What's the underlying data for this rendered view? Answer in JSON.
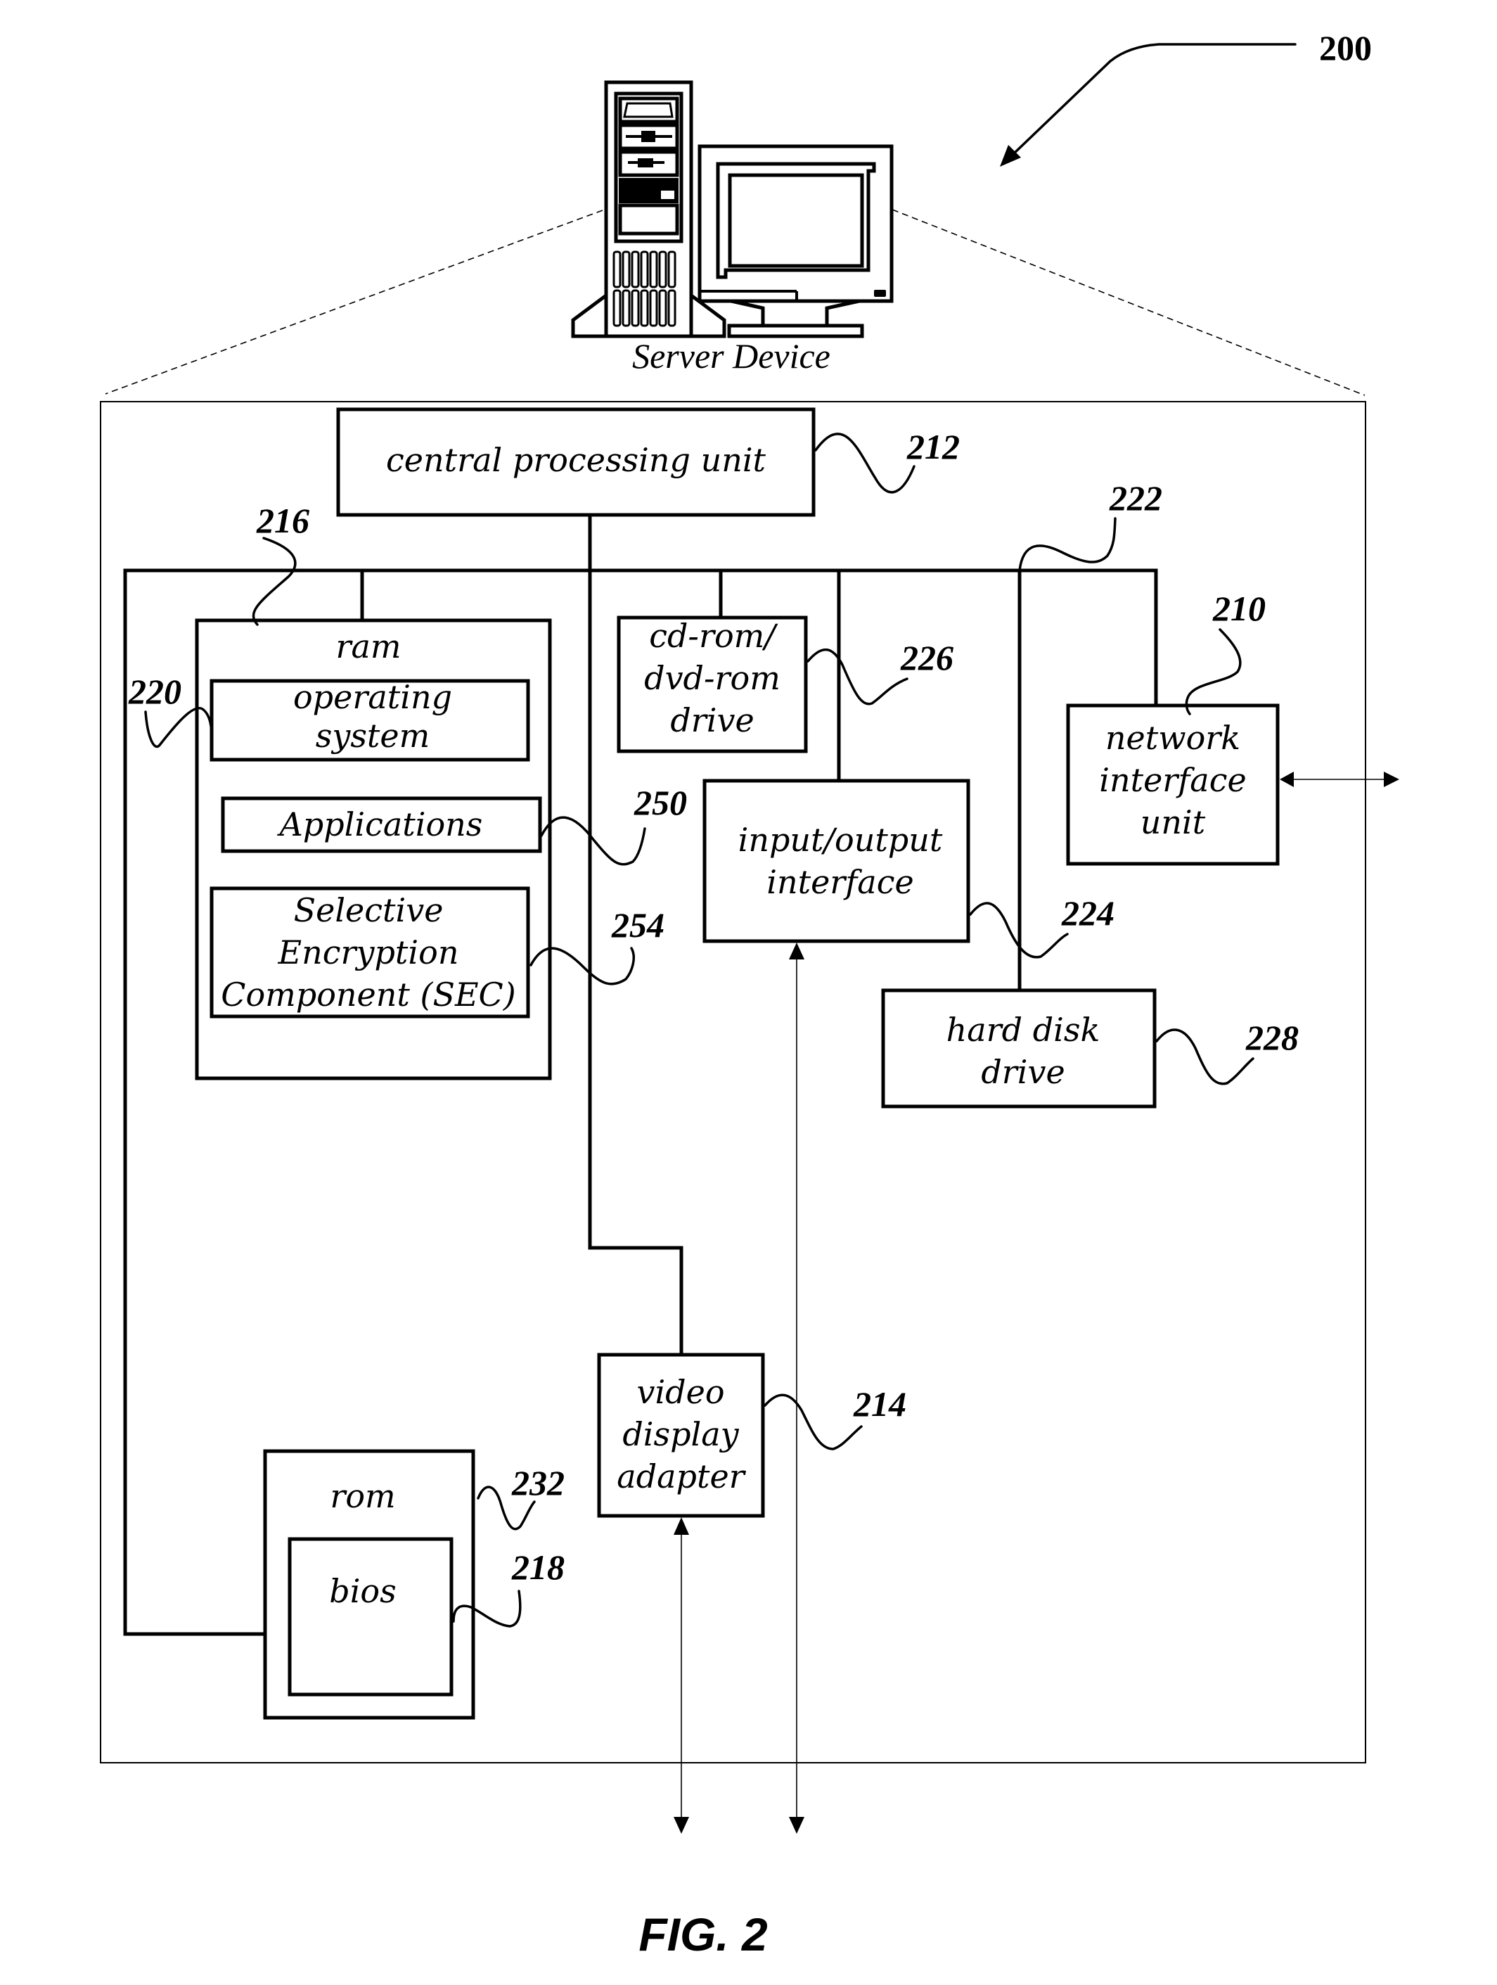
{
  "figure": {
    "label": "FIG. 2",
    "reference_number": "200",
    "device_caption": "Server Device"
  },
  "components": {
    "cpu": {
      "label": [
        "central processing unit"
      ],
      "ref": "212"
    },
    "ram": {
      "label": [
        "ram"
      ],
      "ref": "216"
    },
    "os": {
      "label": [
        "operating",
        "system"
      ],
      "ref": "220"
    },
    "applications": {
      "label": [
        "Applications"
      ],
      "ref": "250"
    },
    "sec": {
      "label": [
        "Selective",
        "Encryption",
        "Component (SEC)"
      ],
      "ref": "254"
    },
    "cdrom": {
      "label": [
        "cd-rom/",
        "dvd-rom",
        "drive"
      ],
      "ref": "226"
    },
    "io": {
      "label": [
        "input/output",
        "interface"
      ],
      "ref": "224"
    },
    "bus": {
      "ref": "222"
    },
    "nic": {
      "label": [
        "network",
        "interface",
        "unit"
      ],
      "ref": "210"
    },
    "hdd": {
      "label": [
        "hard disk",
        "drive"
      ],
      "ref": "228"
    },
    "video": {
      "label": [
        "video",
        "display",
        "adapter"
      ],
      "ref": "214"
    },
    "rom": {
      "label": [
        "rom"
      ],
      "ref": "232"
    },
    "bios": {
      "label": [
        "bios"
      ],
      "ref": "218"
    }
  }
}
